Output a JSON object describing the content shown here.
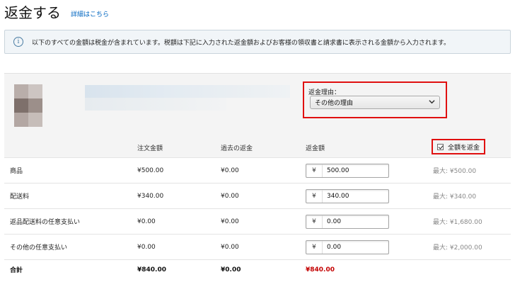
{
  "header": {
    "title": "返金する",
    "detail_link": "詳細はこちら"
  },
  "info": {
    "icon": "info-icon",
    "text": "以下のすべての金額は税金が含まれています。税額は下記に入力された返金額およびお客様の領収書と請求書に表示される金額から入力されます。"
  },
  "product": {
    "thumb_colors": [
      "#b9aeaa",
      "#cdc5c2",
      "#7e706b",
      "#9c8f8a",
      "#b3a7a3",
      "#c6bdb9"
    ],
    "reason_label": "返金理由：",
    "reason_selected": "その他の理由"
  },
  "table": {
    "headers": {
      "item": "",
      "order_amount": "注文金額",
      "past_refund": "過去の返金",
      "refund_amount": "返金額",
      "refund_all": "全額を返金"
    },
    "rows": [
      {
        "label": "商品",
        "order": "¥500.00",
        "past": "¥0.00",
        "yen": "¥",
        "value": "500.00",
        "max": "最大: ¥500.00"
      },
      {
        "label": "配送料",
        "order": "¥340.00",
        "past": "¥0.00",
        "yen": "¥",
        "value": "340.00",
        "max": "最大: ¥340.00"
      },
      {
        "label": "返品配送料の任意支払い",
        "order": "¥0.00",
        "past": "¥0.00",
        "yen": "¥",
        "value": "0.00",
        "max": "最大: ¥1,680.00"
      },
      {
        "label": "その他の任意支払い",
        "order": "¥0.00",
        "past": "¥0.00",
        "yen": "¥",
        "value": "0.00",
        "max": "最大: ¥2,000.00"
      }
    ],
    "total": {
      "label": "合計",
      "order": "¥840.00",
      "past": "¥0.00",
      "refund": "¥840.00"
    }
  },
  "colors": {
    "link": "#0066c0",
    "highlight_border": "#e01010",
    "total_refund": "#c40000"
  }
}
